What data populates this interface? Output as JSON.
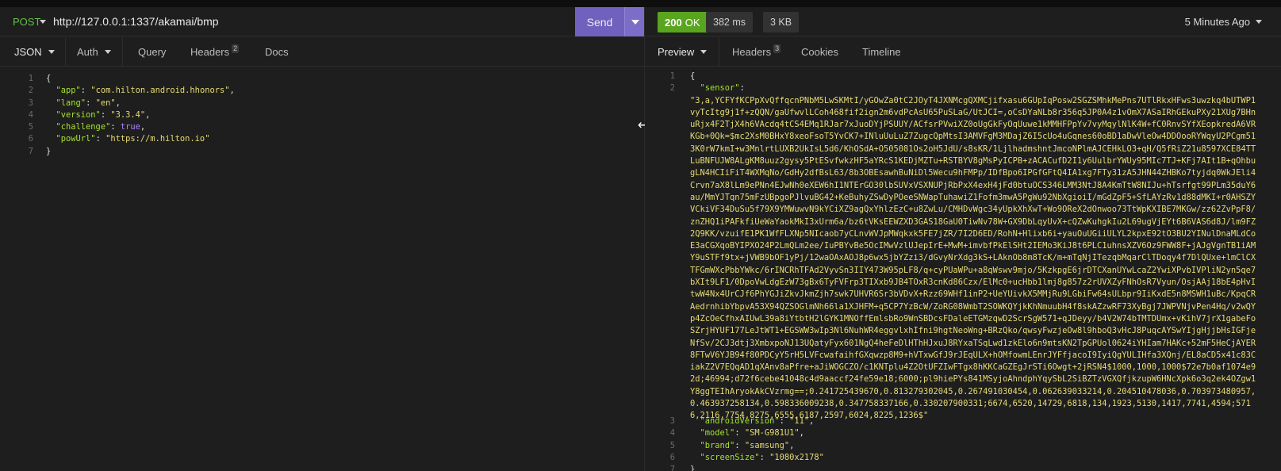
{
  "request": {
    "method": "POST",
    "url": "http://127.0.0.1:1337/akamai/bmp",
    "send_label": "Send",
    "tabs": [
      {
        "label": "JSON"
      },
      {
        "label": "Auth"
      },
      {
        "label": "Query"
      },
      {
        "label": "Headers",
        "badge": "2"
      },
      {
        "label": "Docs"
      }
    ],
    "body_lines": [
      {
        "n": "1"
      },
      {
        "n": "2"
      },
      {
        "n": "3"
      },
      {
        "n": "4"
      },
      {
        "n": "5"
      },
      {
        "n": "6"
      },
      {
        "n": "7"
      }
    ],
    "body": {
      "app_key": "\"app\"",
      "app_val": "\"com.hilton.android.hhonors\"",
      "lang_key": "\"lang\"",
      "lang_val": "\"en\"",
      "version_key": "\"version\"",
      "version_val": "\"3.3.4\"",
      "challenge_key": "\"challenge\"",
      "challenge_val": "true",
      "powurl_key": "\"powUrl\"",
      "powurl_val": "\"https://m.hilton.io\""
    }
  },
  "response": {
    "status_code": "200",
    "status_text": "OK",
    "time": "382 ms",
    "size": "3 KB",
    "time_ago": "5 Minutes Ago",
    "tabs": [
      {
        "label": "Preview"
      },
      {
        "label": "Headers",
        "badge": "3"
      },
      {
        "label": "Cookies"
      },
      {
        "label": "Timeline"
      }
    ],
    "body": {
      "sensor_key": "\"sensor\"",
      "sensor_val": "\"3,a,YCFYfKCPpXvQffqcnPNbM5LwSKMtI/yGOwZa0tC2JOyT4JXNMcgQXMCjifxasu6GUpIqPosw2SGZSMhkMePns7UTlRkxHFws3uwzkq4bUTWP1vyTcItg9j1f+zQQN/gaUfwvlLCoh468fif2ign2m6vdPcAsU65PuSLaG/UtJCI=,oCsDYaNLb8r356q5JP0A4z1vOmX7ASaIRhGEkuPXy21XUg7BHnuRjx4F2TjX4h6VAcdq4tCS4EMq1RJar7xJuoDYjPSUUY/ACfsrPVwiXZ0oUgGkFyOqUuwe1kMMHFPpYv7vyMqylNlK4W+fC0RnvSYfXEopkredA6VRKGb+0Qk=$mc2XsM0BHxY8xeoFsoT5YvCK7+INluUuLuZ7ZugcQpMtsI3AMVFgM3MDajZ6I5cUo4uGqnes60oBD1aDwVleOw4DDOooRYWqyU2PCgm513K0rW7kmI+w3MnlrtLUXB2UkIsL5d6/KhOSdA+O505081Os2oH5JdU/s8sKR/1LjlhadmshntJmcoNPlmAJCEHkLO3+qH/Q5fRiZ21u8597XCE84TTLuBNFUJW8ALgKM8uuz2gysy5PtESvfwkzHF5aYRcS1KEDjMZTu+RSTBYV8gMsPyICPB+zACACufD2I1y6UulbrYWUy95MIc7TJ+KFj7AIt1B+qOhbugLN4HCIiFiT4WXMqNo/GdHy2dfBsL63/8b3OBEsawhBuNiDl5Wecu9hFMPp/IDfBpo6IPGfGFtQ4IA1xg7FTy31zA5JHN44ZHBKo7tyjdq0WkJEli4Crvn7aX8lLm9ePNn4EJwNh0eXEW6hI1NTErGO30lbSUVxVSXNUPjRbPxX4exH4jFd0btuOCS346LMM3NtJ8A4KmTtW8NIJu+hTsrfgt99PLm35duY6au/MmYJTqn75mFzUBpgoPJlvuBG42+KeBuhyZSwDyPOeeSNWapTuhawiZ1Fofm3mwA5PgWu92NbXgioiI/mGdZpF5+SfLAYzRv1d88dMKI+r0AHSZYVCkiVF34DuSu5f79X9YMWuwvN9kYCiXZ9agQxYhlzEzC+u8ZwLu/CMHDvWgc34yUpkXhXwT+Wo9OReX2dOnwoo73TtWpKXIBE7MKGw/zz62ZvPpF8/znZHQ1iPAFkfiUeWaYaokMkI3xUrm6a/bz6tVKsEEWZXD3GAS18GaU0TiwNv78W+GX9DbLqyUvX+cQZwKuhgkIu2L69ugVjEYt6B6VAS6d8J/lm9FZ2Q9KK/vzuifE1PK1WfFLXNp5NIcaob7yCLnvWVJpMWqkxk5FE7jZR/7I2D6ED/RohN+Hlixb6i+yauOuUGiiULYL2kpxE92tO3BU2YINulDnaMLdCoE3aCGXqoBYIPXO24P2LmQLm2ee/IuPBYvBe5OcIMwVzlUJepIrE+MwM+imvbfPkElSHt2IEMo3KiJ8t6PLC1uhnsXZV6Oz9FWW8F+jAJgVgnTB1iAMY9uSTFf9tx+jVWB9bOF1yPj/12waOAxAOJ8p6wx5jbYZzi3/dGvyNrXdg3kS+LAknOb8m8TcK/m+mTqNjITezqbMqarClTDoqy4f7DlQUxe+lmClCXTFGmWXcPbbYWkc/6rINCRhTFAd2VyvSn3IIY473W95pLF8/q+cyPUaWPu+a8qWswv9mjo/5KzkpgE6jrDTCXanUYwLcaZ2YwiXPvbIVPliN2yn5qe7bXIt9LF1/0DpoVwLdgEzW73gBx6TyFVFrp3TIXxb9JB4TOxR3cnKd86Czx/ElMc0+ucHbb1lmj8g857z2rUVXZyFNhOsR7Vyun/OsjAAj18bE4pHvItwW4Nx4UrCJf6PhYGJiZkvJkmZjh7swk7UHVR6Sr3bVDvX+Rzz69WHf1inP2+UeYUivkX5MMjRu9LGbiFw64sULbpr9IiKxdE5n8MSWH1uBc/KpqCRAedrnhibYbpvA53X94QZSOGlmNh66la1XJHFM+q5CP7YzBcW/ZoRG08WmbT2SOWKQYjkKhNmuubH4f8skAZzwRF73XyBgj7JWPVNjvPen4Hq/v2wQYp4ZcOeCfhxAIUwL39a8iYtbtH2lGYK1MNOffEmlsbRo9WnSBDcsFDaleETGMzqwD2ScrSgW571+qJDeyy/b4V2W74bTMTDUmx+vKihV7jrX1gabeFoSZrjHYUF177LeJtWT1+EGSWW3wIp3Nl6NuhWR4eggvlxhIfni9hgtNeoWng+BRzQko/qwsyFwzjeOw8l9hboQ3vHcJ8PuqcAYSwYIjgHjjbHsIGFjeNfSv/2CJ3dtj3XmbxpoNJ13UQatyFyx601NgQ4heFeDlHThHJxuJ8RYxaTSqLwd1zkElo6n9mtsKN2TpGPUol0624iYHIam7HAKc+52mF5HeCjAYER8FTwV6YJB94f80PDCyY5rH5LVFcwafaihfGXqwzp8M9+hVTxwGfJ9rJEqULX+hOMfowmLEnrJYFfjacoI9IyiQgYULIHfa3XQnj/EL8aCD5x41c83CiakZ2V7EQqAD1qXAnv8aPfre+aJiWOGCZO/c1KNTplu4Z2OtUFZIwFTgx8hKKCaGZEgJrSTi6Owgt+2jRSN4$1000,1000,1000$72e7b0af1074e92d;46994;d72f6cebe41048c4d9aaccf24fe59e18;6000;pl9hiePYs841MSyjoAhndphYqySbL2SiBZTzVGXQfjkzupW6HNcXpk6o3q2ek4OZgw1Y8ggTEIhAryokAkCVzrmg==;0.241725439670,0.813279302045,0.267491030454,0.062639033214,0.204510478036,0.703973480957,0.463937258134,0.598336009238,0.347758337166,0.330207900331;6674,6520,14729,6818,134,1923,5130,1417,7741,4594;5716,2116,7754,8275,6555,6187,2597,6024,8225,1236$\"",
      "android_key": "\"androidVersion\"",
      "android_val": "\"11\"",
      "model_key": "\"model\"",
      "model_val": "\"SM-G981U1\"",
      "brand_key": "\"brand\"",
      "brand_val": "\"samsung\"",
      "screen_key": "\"screenSize\"",
      "screen_val": "\"1080x2178\""
    }
  },
  "colors": {
    "send_button": "#6f61bd",
    "status_ok": "#59a51f",
    "method": "#63c147",
    "json_key": "#a6e22e",
    "json_string": "#e6db74",
    "json_bool": "#ae81ff"
  }
}
